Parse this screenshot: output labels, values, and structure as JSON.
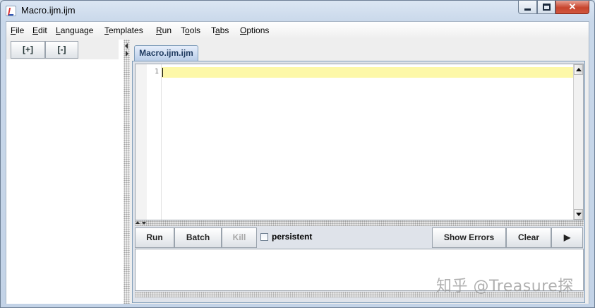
{
  "window": {
    "title": "Macro.ijm.ijm",
    "controls": {
      "close_glyph": "✕"
    }
  },
  "menubar": {
    "items": [
      "File",
      "Edit",
      "Language",
      "Templates",
      "Run",
      "Tools",
      "Tabs",
      "Options"
    ]
  },
  "left_panel": {
    "expand_label": "[+]",
    "collapse_label": "[-]"
  },
  "editor": {
    "tab_label": "Macro.ijm.ijm",
    "line_numbers": [
      "1"
    ],
    "content": ""
  },
  "toolbar": {
    "run_label": "Run",
    "batch_label": "Batch",
    "kill_label": "Kill",
    "persistent_label": "persistent",
    "persistent_checked": false,
    "show_errors_label": "Show Errors",
    "clear_label": "Clear",
    "more_glyph": "▶"
  },
  "watermark": {
    "text": "知乎 @Treasure探"
  },
  "colors": {
    "current_line": "#fdf8a8",
    "tab_text": "#1e3a5f",
    "close_button": "#c7442d"
  }
}
